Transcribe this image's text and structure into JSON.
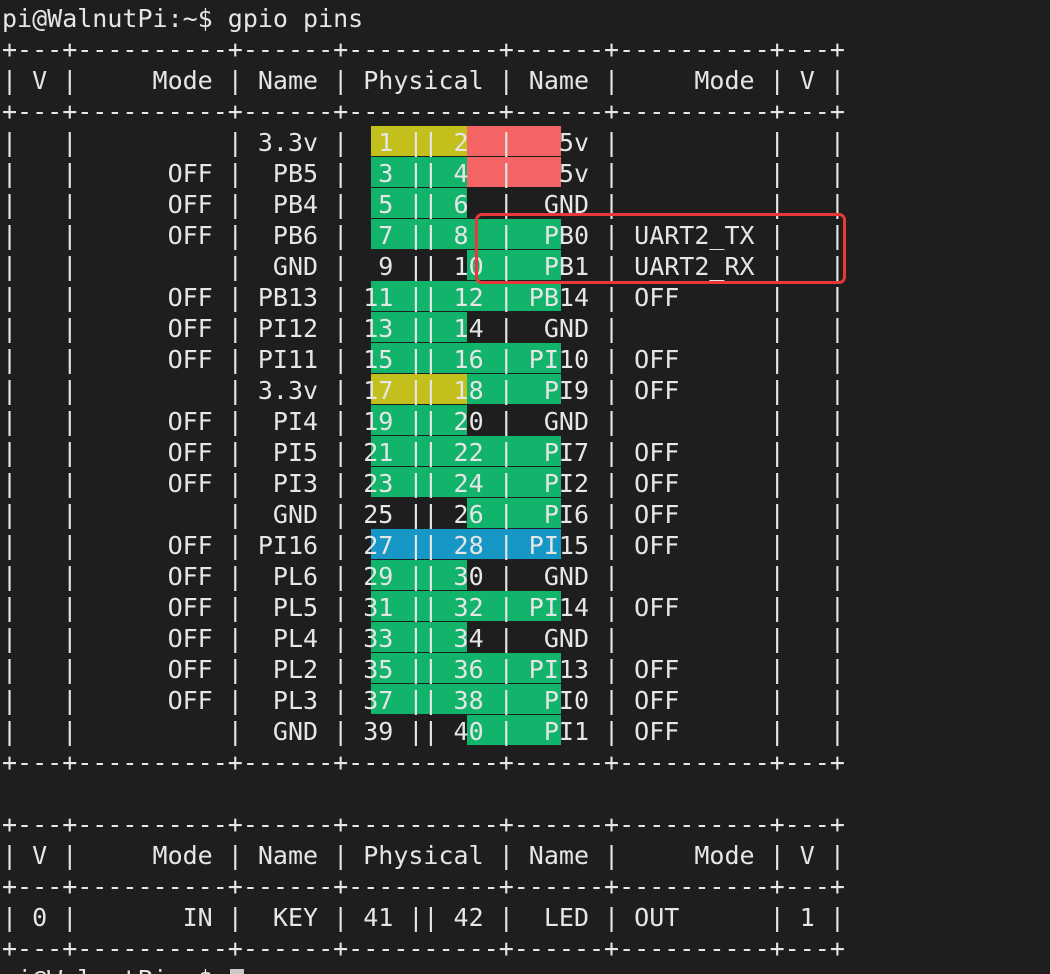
{
  "colors": {
    "background": "#1e1e1e",
    "text": "#e6e6e6",
    "power_3v3": "#c3bf1c",
    "power_5v": "#f46464",
    "gpio": "#12b46c",
    "special": "#1797c6",
    "highlight_border": "#e8383a",
    "cursor": "#c9c9c9"
  },
  "terminal": {
    "lines": [
      "pi@WalnutPi:~$ gpio pins",
      "+---+----------+------+----------+------+----------+---+",
      "| V |     Mode | Name | Physical | Name |     Mode | V |",
      "+---+----------+------+----------+------+----------+---+",
      "|   |          | 3.3v |  1 || 2  |   5v |          |   |",
      "|   |      OFF |  PB5 |  3 || 4  |   5v |          |   |",
      "|   |      OFF |  PB4 |  5 || 6  |  GND |          |   |",
      "|   |      OFF |  PB6 |  7 || 8  |  PB0 | UART2_TX |   |",
      "|   |          |  GND |  9 || 10 |  PB1 | UART2_RX |   |",
      "|   |      OFF | PB13 | 11 || 12 | PB14 | OFF      |   |",
      "|   |      OFF | PI12 | 13 || 14 |  GND |          |   |",
      "|   |      OFF | PI11 | 15 || 16 | PI10 | OFF      |   |",
      "|   |          | 3.3v | 17 || 18 |  PI9 | OFF      |   |",
      "|   |      OFF |  PI4 | 19 || 20 |  GND |          |   |",
      "|   |      OFF |  PI5 | 21 || 22 |  PI7 | OFF      |   |",
      "|   |      OFF |  PI3 | 23 || 24 |  PI2 | OFF      |   |",
      "|   |          |  GND | 25 || 26 |  PI6 | OFF      |   |",
      "|   |      OFF | PI16 | 27 || 28 | PI15 | OFF      |   |",
      "|   |      OFF |  PL6 | 29 || 30 |  GND |          |   |",
      "|   |      OFF |  PL5 | 31 || 32 | PI14 | OFF      |   |",
      "|   |      OFF |  PL4 | 33 || 34 |  GND |          |   |",
      "|   |      OFF |  PL2 | 35 || 36 | PI13 | OFF      |   |",
      "|   |      OFF |  PL3 | 37 || 38 |  PI0 | OFF      |   |",
      "|   |          |  GND | 39 || 40 |  PI1 | OFF      |   |",
      "+---+----------+------+----------+------+----------+---+",
      "",
      "+---+----------+------+----------+------+----------+---+",
      "| V |     Mode | Name | Physical | Name |     Mode | V |",
      "+---+----------+------+----------+------+----------+---+",
      "| 0 |       IN |  KEY | 41 || 42 |  LED | OUT      | 1 |",
      "+---+----------+------+----------+------+----------+---+",
      "pi@WalnutPi:~$ "
    ]
  },
  "pin_colors": {
    "left": [
      "power_3v3",
      "gpio",
      "gpio",
      "gpio",
      "",
      "gpio",
      "gpio",
      "gpio",
      "power_3v3",
      "gpio",
      "gpio",
      "gpio",
      "",
      "special",
      "gpio",
      "gpio",
      "gpio",
      "gpio",
      "gpio",
      ""
    ],
    "right": [
      "power_5v",
      "power_5v",
      "",
      "gpio",
      "gpio",
      "gpio",
      "",
      "gpio",
      "gpio",
      "",
      "gpio",
      "gpio",
      "gpio",
      "special",
      "",
      "gpio",
      "",
      "gpio",
      "gpio",
      "gpio"
    ]
  }
}
